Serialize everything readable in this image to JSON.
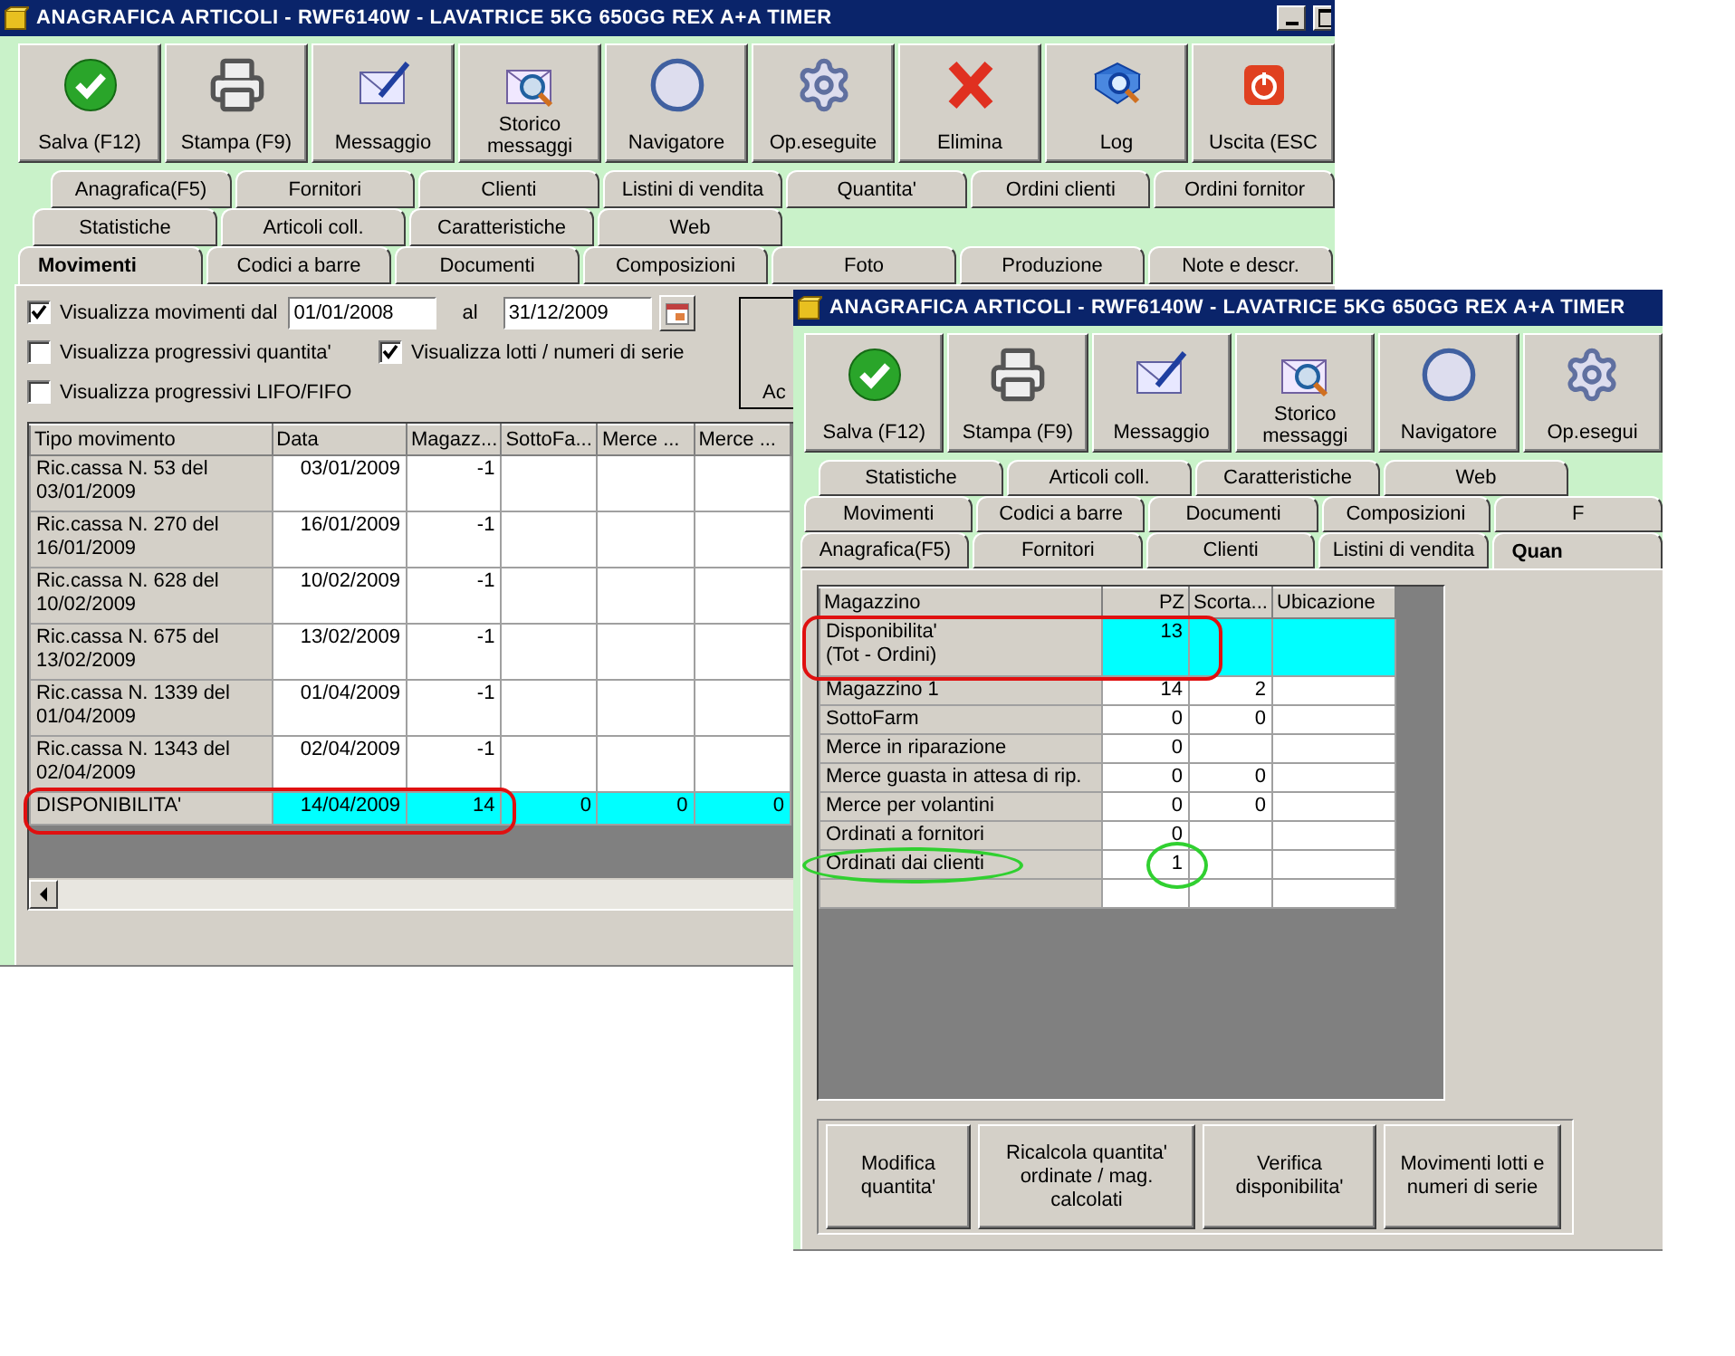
{
  "back_window": {
    "title": "ANAGRAFICA ARTICOLI - RWF6140W - LAVATRICE 5KG 650GG REX A+A TIMER",
    "toolbar": [
      {
        "kind": "save",
        "label": "Salva (F12)"
      },
      {
        "kind": "print",
        "label": "Stampa (F9)"
      },
      {
        "kind": "message",
        "label": "Messaggio"
      },
      {
        "kind": "history",
        "label": "Storico messaggi"
      },
      {
        "kind": "navigator",
        "label": "Navigatore"
      },
      {
        "kind": "operations",
        "label": "Op.eseguite"
      },
      {
        "kind": "delete",
        "label": "Elimina"
      },
      {
        "kind": "log",
        "label": "Log"
      },
      {
        "kind": "exit",
        "label": "Uscita (ESC"
      }
    ],
    "tab_rows": [
      [
        {
          "label": "Anagrafica(F5)",
          "selected": false
        },
        {
          "label": "Fornitori",
          "selected": false
        },
        {
          "label": "Clienti",
          "selected": false
        },
        {
          "label": "Listini di vendita",
          "selected": false
        },
        {
          "label": "Quantita'",
          "selected": false
        },
        {
          "label": "Ordini clienti",
          "selected": false
        },
        {
          "label": "Ordini fornitor",
          "selected": false
        }
      ],
      [
        {
          "label": "Statistiche",
          "selected": false
        },
        {
          "label": "Articoli coll.",
          "selected": false
        },
        {
          "label": "Caratteristiche",
          "selected": false
        },
        {
          "label": "Web",
          "selected": false
        }
      ],
      [
        {
          "label": "Movimenti",
          "selected": true
        },
        {
          "label": "Codici a barre",
          "selected": false
        },
        {
          "label": "Documenti",
          "selected": false
        },
        {
          "label": "Composizioni",
          "selected": false
        },
        {
          "label": "Foto",
          "selected": false
        },
        {
          "label": "Produzione",
          "selected": false
        },
        {
          "label": "Note e descr.",
          "selected": false
        }
      ]
    ],
    "options": [
      {
        "label": "Visualizza movimenti dal",
        "checked": true
      },
      {
        "label": "Visualizza progressivi quantita'",
        "checked": false
      },
      {
        "label": "Visualizza lotti /  numeri di serie",
        "checked": true
      },
      {
        "label": "Visualizza progressivi LIFO/FIFO",
        "checked": false
      }
    ],
    "date_from": "01/01/2008",
    "date_to_label": "al",
    "date_to": "31/12/2009",
    "side_button": "Ac",
    "table": {
      "columns": [
        "Tipo movimento",
        "Data",
        "Magazz...",
        "SottoFa...",
        "Merce ...",
        "Merce ..."
      ],
      "rows": [
        {
          "type": "Ric.cassa N. 53 del 03/01/2009",
          "date": "03/01/2009",
          "values": [
            "-1"
          ],
          "highlighted": false
        },
        {
          "type": "Ric.cassa N. 270 del 16/01/2009",
          "date": "16/01/2009",
          "values": [
            "-1"
          ],
          "highlighted": false
        },
        {
          "type": "Ric.cassa N. 628 del 10/02/2009",
          "date": "10/02/2009",
          "values": [
            "-1"
          ],
          "highlighted": false
        },
        {
          "type": "Ric.cassa N. 675 del 13/02/2009",
          "date": "13/02/2009",
          "values": [
            "-1"
          ],
          "highlighted": false
        },
        {
          "type": "Ric.cassa N. 1339 del 01/04/2009",
          "date": "01/04/2009",
          "values": [
            "-1"
          ],
          "highlighted": false
        },
        {
          "type": "Ric.cassa N. 1343 del 02/04/2009",
          "date": "02/04/2009",
          "values": [
            "-1"
          ],
          "highlighted": false
        },
        {
          "type": "DISPONIBILITA'",
          "date": "14/04/2009",
          "values": [
            "14",
            "0",
            "0",
            "0"
          ],
          "highlighted": true,
          "ring": {
            "kind": "box",
            "color": "#e01010"
          }
        }
      ]
    }
  },
  "front_window": {
    "title": "ANAGRAFICA ARTICOLI - RWF6140W - LAVATRICE 5KG 650GG REX A+A TIMER",
    "toolbar": [
      {
        "kind": "save",
        "label": "Salva (F12)"
      },
      {
        "kind": "print",
        "label": "Stampa (F9)"
      },
      {
        "kind": "message",
        "label": "Messaggio"
      },
      {
        "kind": "history",
        "label": "Storico messaggi"
      },
      {
        "kind": "navigator",
        "label": "Navigatore"
      },
      {
        "kind": "operations",
        "label": "Op.esegui"
      }
    ],
    "tab_rows": [
      [
        {
          "label": "Statistiche",
          "selected": false
        },
        {
          "label": "Articoli coll.",
          "selected": false
        },
        {
          "label": "Caratteristiche",
          "selected": false
        },
        {
          "label": "Web",
          "selected": false
        }
      ],
      [
        {
          "label": "Movimenti",
          "selected": false
        },
        {
          "label": "Codici a barre",
          "selected": false
        },
        {
          "label": "Documenti",
          "selected": false
        },
        {
          "label": "Composizioni",
          "selected": false
        },
        {
          "label": "F",
          "selected": false
        }
      ],
      [
        {
          "label": "Anagrafica(F5)",
          "selected": false
        },
        {
          "label": "Fornitori",
          "selected": false
        },
        {
          "label": "Clienti",
          "selected": false
        },
        {
          "label": "Listini di vendita",
          "selected": false
        },
        {
          "label": "Quan",
          "selected": true
        }
      ]
    ],
    "table": {
      "columns": [
        "Magazzino",
        "PZ",
        "Scorta...",
        "Ubicazione"
      ],
      "rows": [
        {
          "name": "Disponibilita'\n (Tot - Ordini)",
          "values": [
            "13"
          ],
          "highlighted": true,
          "ring": {
            "kind": "box",
            "color": "#e01010"
          }
        },
        {
          "name": "Magazzino 1",
          "values": [
            "14",
            "2"
          ],
          "highlighted": false
        },
        {
          "name": "SottoFarm",
          "values": [
            "0",
            "0"
          ],
          "highlighted": false
        },
        {
          "name": "Merce in riparazione",
          "values": [
            "0"
          ],
          "highlighted": false
        },
        {
          "name": "Merce guasta in attesa di rip.",
          "values": [
            "0",
            "0"
          ],
          "highlighted": false
        },
        {
          "name": "Merce per volantini",
          "values": [
            "0",
            "0"
          ],
          "highlighted": false
        },
        {
          "name": "Ordinati a fornitori",
          "values": [
            "0"
          ],
          "highlighted": false
        },
        {
          "name": "Ordinati dai clienti",
          "values": [
            "1"
          ],
          "highlighted": false,
          "ring": {
            "kind": "ellipse",
            "color": "#30d030"
          }
        }
      ]
    },
    "buttons": [
      "Modifica quantita'",
      "Ricalcola quantita' ordinate / mag. calcolati",
      "Verifica disponibilita'",
      "Movimenti lotti e numeri di serie"
    ]
  }
}
